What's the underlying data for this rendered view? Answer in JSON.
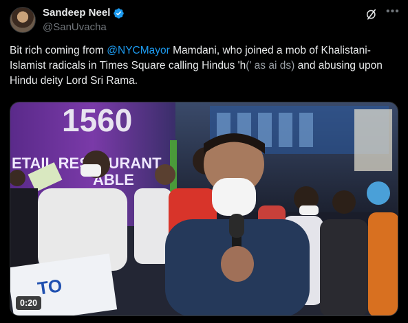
{
  "author": {
    "name": "Sandeep Neel",
    "handle": "@SanUvacha"
  },
  "tweet": {
    "text_before": "Bit rich coming from ",
    "mention": "@NYCMayor",
    "text_after": " Mamdani, who joined a mob of Khalistani-Islamist radicals in Times Square calling Hindus 'h",
    "text_obscured": "(' as ai ds)",
    "text_end": " and abusing upon Hindu deity Lord Sri Rama."
  },
  "video": {
    "duration": "0:20",
    "sign_number": "1560",
    "sign_text": "ETAIL RESTAURANT",
    "sign_text2": "ABLE",
    "banner_text": "TO"
  },
  "colors": {
    "accent": "#1d9bf0",
    "text": "#e7e9ea",
    "secondary": "#71767b",
    "background": "#000000"
  },
  "icons": [
    "verified-badge-icon",
    "grok-icon",
    "more-options-icon",
    "video-play-icon"
  ]
}
